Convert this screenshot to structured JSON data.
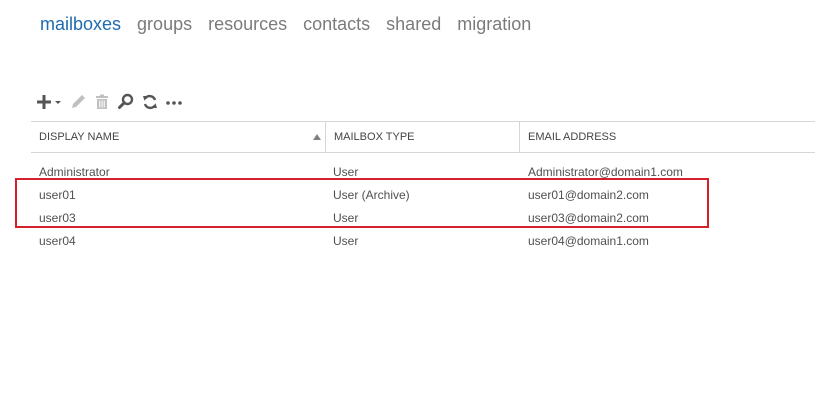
{
  "tabs": [
    {
      "label": "mailboxes",
      "active": true
    },
    {
      "label": "groups",
      "active": false
    },
    {
      "label": "resources",
      "active": false
    },
    {
      "label": "contacts",
      "active": false
    },
    {
      "label": "shared",
      "active": false
    },
    {
      "label": "migration",
      "active": false
    }
  ],
  "toolbar": {
    "icons": [
      "add-icon",
      "edit-icon",
      "delete-icon",
      "search-icon",
      "refresh-icon",
      "more-icon"
    ]
  },
  "table": {
    "columns": [
      "DISPLAY NAME",
      "MAILBOX TYPE",
      "EMAIL ADDRESS"
    ],
    "sort_column": "DISPLAY NAME",
    "sort_direction": "ascending",
    "rows": [
      {
        "display_name": "Administrator",
        "mailbox_type": "User",
        "email": "Administrator@domain1.com"
      },
      {
        "display_name": "user01",
        "mailbox_type": "User (Archive)",
        "email": "user01@domain2.com"
      },
      {
        "display_name": "user03",
        "mailbox_type": "User",
        "email": "user03@domain2.com"
      },
      {
        "display_name": "user04",
        "mailbox_type": "User",
        "email": "user04@domain1.com"
      }
    ]
  },
  "colors": {
    "active_tab": "#1f6bb0",
    "inactive_tab": "#7b7b7b",
    "highlight_border": "#d4202a",
    "toolbar_icon": "#555555",
    "toolbar_icon_disabled": "#c0c0c0"
  }
}
